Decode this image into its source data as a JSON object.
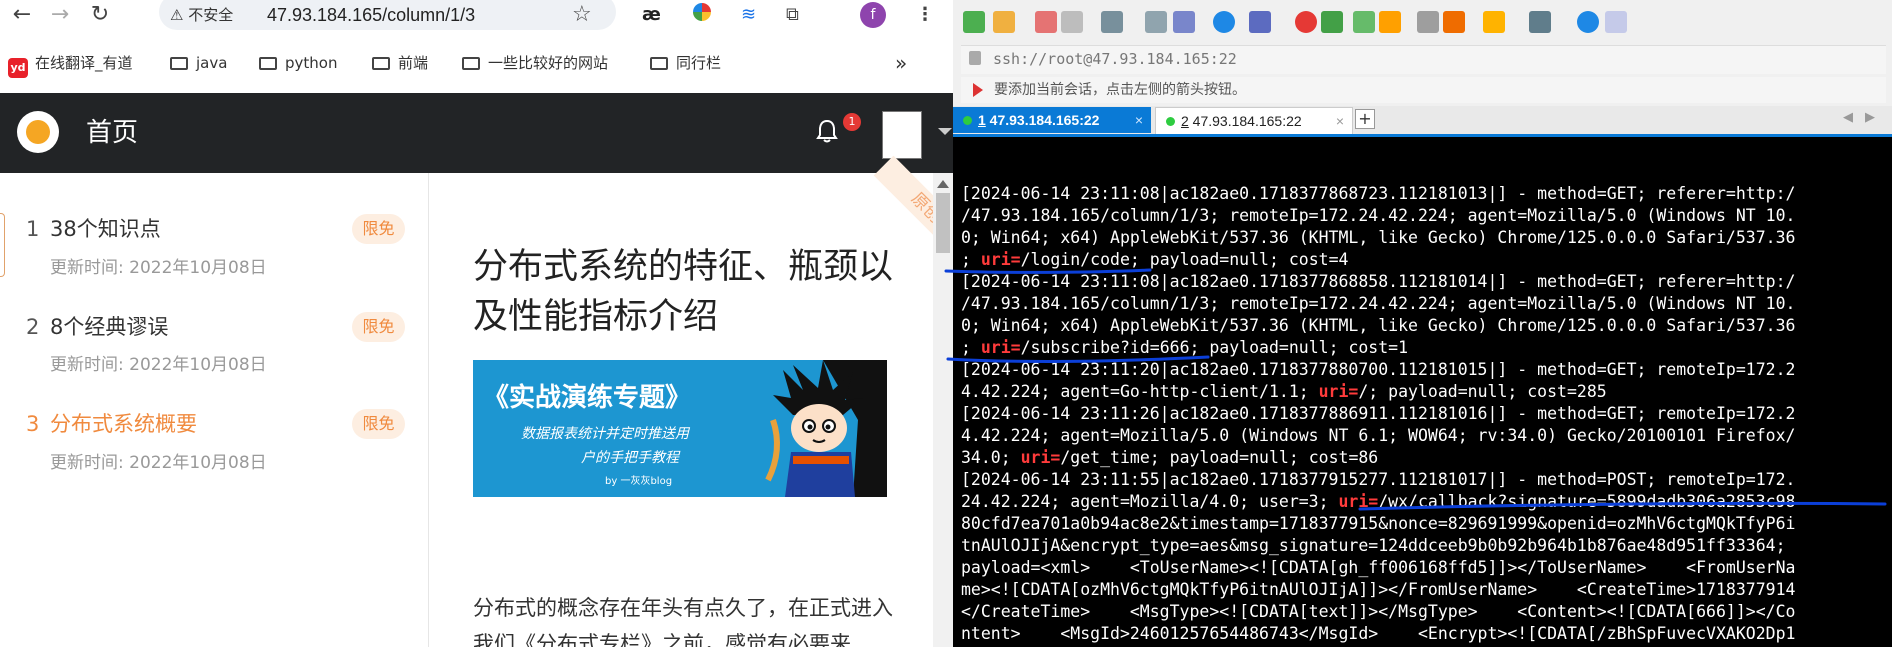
{
  "browser": {
    "insecure_label": "不安全",
    "url": "47.93.184.165/column/1/3",
    "profile_initial": "f",
    "bookmarks": [
      "在线翻译_有道",
      "java",
      "python",
      "前端",
      "一些比较好的网站",
      "同行栏"
    ],
    "bookmark_more": "»"
  },
  "site": {
    "title": "首页",
    "notification_count": "1"
  },
  "sidebar": {
    "chapters": [
      {
        "num": "1",
        "title": "38个知识点",
        "date": "更新时间: 2022年10月08日",
        "tag": "限免"
      },
      {
        "num": "2",
        "title": "8个经典谬误",
        "date": "更新时间: 2022年10月08日",
        "tag": "限免"
      },
      {
        "num": "3",
        "title": "分布式系统概要",
        "date": "更新时间: 2022年10月08日",
        "tag": "限免"
      }
    ]
  },
  "article": {
    "ribbon": "原创",
    "title": "分布式系统的特征、瓶颈以及性能指标介绍",
    "banner_title": "《实战演练专题》",
    "banner_sub1": "数据报表统计并定时推送用",
    "banner_sub2": "户的手把手教程",
    "banner_by": "by 一灰灰blog",
    "body_start": "分布式的概念存在年头有点久了，在正式进入我们《分布式专栏》之前，感觉有必要来"
  },
  "xshell": {
    "address": "ssh://root@47.93.184.165:22",
    "tip": "要添加当前会话，点击左侧的箭头按钮。",
    "tabs": [
      {
        "num": "1",
        "host": " 47.93.184.165:22"
      },
      {
        "num": "2",
        "host": " 47.93.184.165:22"
      }
    ],
    "tab_close": "×",
    "tab_add": "+"
  },
  "terminal": {
    "lines": [
      {
        "pre": "[2024-06-14 23:11:08|ac182ae0.1718377868723.112181013|] - method=GET; referer=http:/",
        "uri": "",
        "post": ""
      },
      {
        "pre": "/47.93.184.165/column/1/3; remoteIp=172.24.42.224; agent=Mozilla/5.0 (Windows NT 10.",
        "uri": "",
        "post": ""
      },
      {
        "pre": "0; Win64; x64) AppleWebKit/537.36 (KHTML, like Gecko) Chrome/125.0.0.0 Safari/537.36",
        "uri": "",
        "post": ""
      },
      {
        "pre": "; ",
        "uri": "uri=",
        "post": "/login/code; payload=null; cost=4"
      },
      {
        "pre": "[2024-06-14 23:11:08|ac182ae0.1718377868858.112181014|] - method=GET; referer=http:/",
        "uri": "",
        "post": ""
      },
      {
        "pre": "/47.93.184.165/column/1/3; remoteIp=172.24.42.224; agent=Mozilla/5.0 (Windows NT 10.",
        "uri": "",
        "post": ""
      },
      {
        "pre": "0; Win64; x64) AppleWebKit/537.36 (KHTML, like Gecko) Chrome/125.0.0.0 Safari/537.36",
        "uri": "",
        "post": ""
      },
      {
        "pre": "; ",
        "uri": "uri=",
        "post": "/subscribe?id=666; payload=null; cost=1"
      },
      {
        "pre": "[2024-06-14 23:11:20|ac182ae0.1718377880700.112181015|] - method=GET; remoteIp=172.2",
        "uri": "",
        "post": ""
      },
      {
        "pre": "4.42.224; agent=Go-http-client/1.1; ",
        "uri": "uri=",
        "post": "/; payload=null; cost=285"
      },
      {
        "pre": "[2024-06-14 23:11:26|ac182ae0.1718377886911.112181016|] - method=GET; remoteIp=172.2",
        "uri": "",
        "post": ""
      },
      {
        "pre": "4.42.224; agent=Mozilla/5.0 (Windows NT 6.1; WOW64; rv:34.0) Gecko/20100101 Firefox/",
        "uri": "",
        "post": ""
      },
      {
        "pre": "34.0; ",
        "uri": "uri=",
        "post": "/get_time; payload=null; cost=86"
      },
      {
        "pre": "[2024-06-14 23:11:55|ac182ae0.1718377915277.112181017|] - method=POST; remoteIp=172.",
        "uri": "",
        "post": ""
      },
      {
        "pre": "24.42.224; agent=Mozilla/4.0; user=3; ",
        "uri": "uri=",
        "post": "/wx/callback?signature=5899dadb306a2853c98"
      },
      {
        "pre": "80cfd7ea701a0b94ac8e2&timestamp=1718377915&nonce=829691999&openid=ozMhV6ctgMQkTfyP6i",
        "uri": "",
        "post": ""
      },
      {
        "pre": "tnAUlOJIjA&encrypt_type=aes&msg_signature=124ddceeb9b0b92b964b1b876ae48d951ff33364;",
        "uri": "",
        "post": ""
      },
      {
        "pre": "payload=<xml>    <ToUserName><![CDATA[gh_ff006168ffd5]]></ToUserName>    <FromUserNa",
        "uri": "",
        "post": ""
      },
      {
        "pre": "me><![CDATA[ozMhV6ctgMQkTfyP6itnAUlOJIjA]]></FromUserName>    <CreateTime>1718377914",
        "uri": "",
        "post": ""
      },
      {
        "pre": "</CreateTime>    <MsgType><![CDATA[text]]></MsgType>    <Content><![CDATA[666]]></Co",
        "uri": "",
        "post": ""
      },
      {
        "pre": "ntent>    <MsgId>24601257654486743</MsgId>    <Encrypt><![CDATA[/zBhSpFuvecVXAKO2Dp1",
        "uri": "",
        "post": ""
      }
    ]
  },
  "colors": {
    "accent_orange": "#f08a3e",
    "site_header": "#222426",
    "xshell_tab_active": "#0a7ad6",
    "uri_red": "#ff3b3b",
    "annotation_blue": "#0b3fd8"
  }
}
